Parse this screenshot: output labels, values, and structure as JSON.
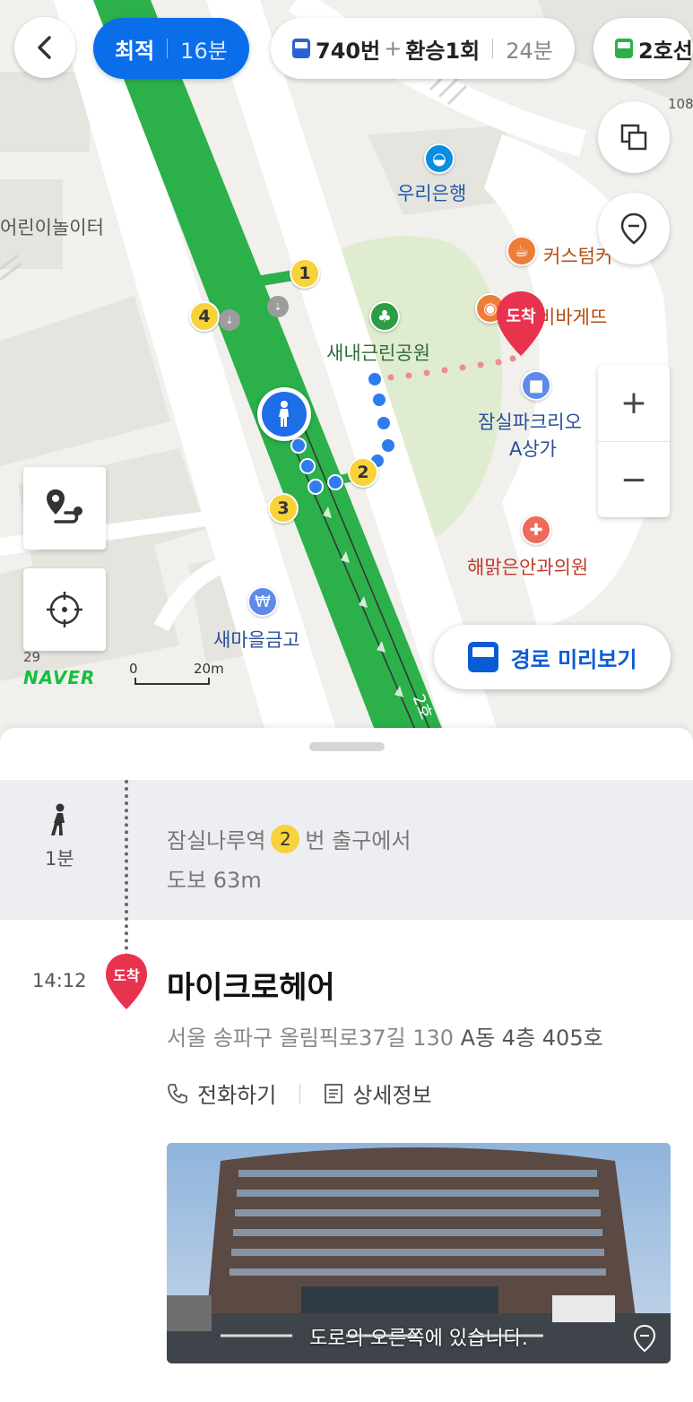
{
  "route_tabs": [
    {
      "label": "최적",
      "time": "16분",
      "active": true
    },
    {
      "label": "740번",
      "plus": "+",
      "transfer": "환승1회",
      "time": "24분"
    },
    {
      "label": "2호선"
    }
  ],
  "map": {
    "pois": {
      "bank": "우리은행",
      "playground": "어린이놀이터",
      "cafe": "커스텀커",
      "bakery": "비바게뜨",
      "park": "새내근린공원",
      "mall": "잠실파크리오\nA상가",
      "mall_line1": "잠실파크리오",
      "mall_line2": "A상가",
      "clinic": "해맑은안과의원",
      "saemaul": "새마을금고"
    },
    "arrival_pin": "도착",
    "exits": [
      "1",
      "2",
      "3",
      "4"
    ],
    "numbers": {
      "top_right": "108",
      "left_29": "29"
    },
    "road_label": "2호",
    "logo": "NAVER",
    "scale": {
      "zero": "0",
      "label": "20m"
    },
    "preview_button": "경로 미리보기",
    "zoom_in": "+",
    "zoom_out": "−"
  },
  "sheet": {
    "walk": {
      "duration": "1분",
      "from_station": "잠실나루역",
      "exit": "2",
      "suffix": "번 출구에서",
      "distance": "도보 63m"
    },
    "arrival": {
      "time": "14:12",
      "pin": "도착",
      "name": "마이크로헤어",
      "address_light": "서울 송파구 올림픽로37길 130",
      "address_dark": " A동 4층 405호",
      "call": "전화하기",
      "detail": "상세정보"
    },
    "photo_caption": "도로의 오른쪽에 있습니다."
  },
  "colors": {
    "accent": "#0a6dea",
    "route_green": "#2bb04a",
    "pin_red": "#e8334f",
    "exit_yellow": "#f7d23a"
  }
}
